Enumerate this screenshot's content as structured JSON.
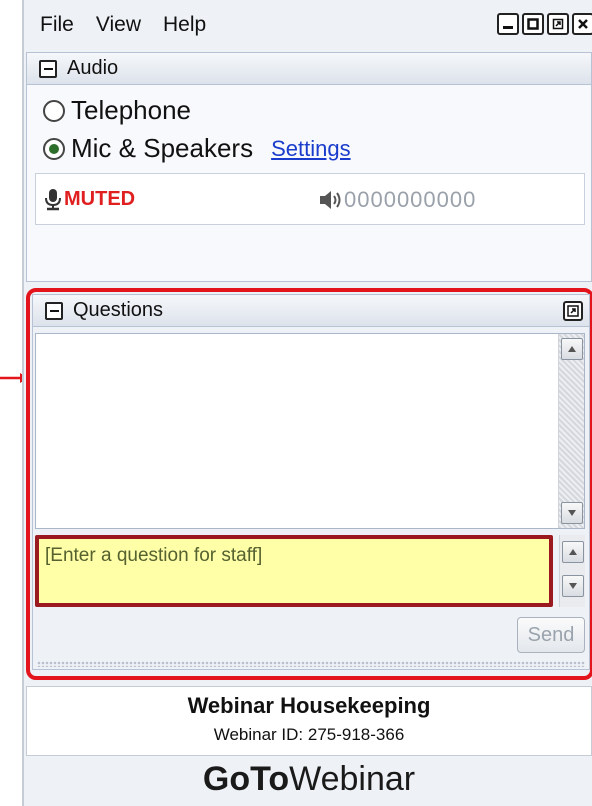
{
  "menu": {
    "items": [
      {
        "label": "File"
      },
      {
        "label": "View"
      },
      {
        "label": "Help"
      }
    ]
  },
  "window_controls": [
    "minimize-icon",
    "maximize-icon",
    "restore-icon",
    "close-icon"
  ],
  "audio": {
    "title": "Audio",
    "options": [
      {
        "label": "Telephone",
        "selected": false
      },
      {
        "label": "Mic & Speakers",
        "selected": true
      }
    ],
    "settings_link": "Settings",
    "mic_status": "MUTED",
    "speaker_levels": "0000000000"
  },
  "questions": {
    "title": "Questions",
    "input_placeholder": "[Enter a question for staff]",
    "send_label": "Send"
  },
  "webinar": {
    "title": "Webinar Housekeeping",
    "id_text": "Webinar ID: 275-918-366"
  },
  "brand": {
    "bold": "GoTo",
    "light": "Webinar"
  },
  "colors": {
    "highlight_red": "#e3141b",
    "muted_red": "#e02020",
    "link_blue": "#1a3ccc",
    "input_yellow": "#ffffa8"
  }
}
